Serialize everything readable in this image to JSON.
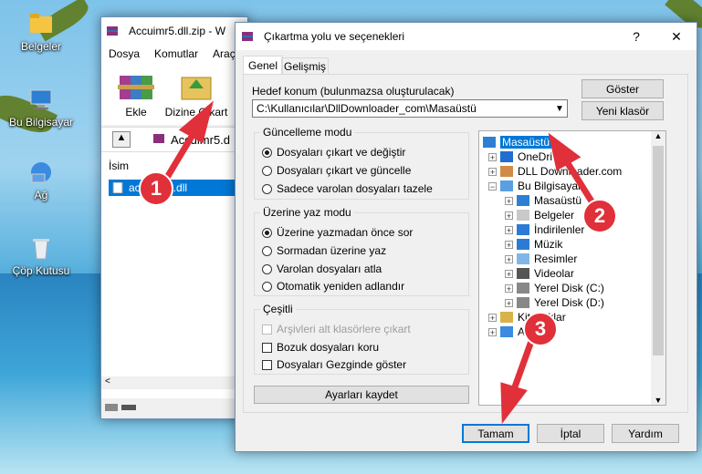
{
  "desktop": {
    "icons": [
      {
        "label": "Belgeler",
        "icon": "folder-icon"
      },
      {
        "label": "Bu Bilgisayar",
        "icon": "computer-icon"
      },
      {
        "label": "Ağ",
        "icon": "network-icon"
      },
      {
        "label": "Çöp Kutusu",
        "icon": "recycle-bin-icon"
      }
    ]
  },
  "winrar": {
    "title": "Accuimr5.dll.zip - W",
    "menu": [
      "Dosya",
      "Komutlar",
      "Araçla"
    ],
    "toolbar": {
      "add": "Ekle",
      "extract": "Dizine Çıkart"
    },
    "path": "Accuimr5.d",
    "column_name": "İsim",
    "file": "accuimr5.dll"
  },
  "dialog": {
    "title": "Çıkartma yolu ve seçenekleri",
    "help": "?",
    "close": "✕",
    "tabs": [
      "Genel",
      "Gelişmiş"
    ],
    "dest_label": "Hedef konum (bulunmazsa oluşturulacak)",
    "dest_value": "C:\\Kullanıcılar\\DllDownloader_com\\Masaüstü",
    "show_btn": "Göster",
    "newfolder_btn": "Yeni klasör",
    "update_group": {
      "title": "Güncelleme modu",
      "options": [
        "Dosyaları çıkart ve değiştir",
        "Dosyaları çıkart ve güncelle",
        "Sadece varolan dosyaları tazele"
      ],
      "selected": 0
    },
    "overwrite_group": {
      "title": "Üzerine yaz modu",
      "options": [
        "Üzerine yazmadan önce sor",
        "Sormadan üzerine yaz",
        "Varolan dosyaları atla",
        "Otomatik yeniden adlandır"
      ],
      "selected": 0
    },
    "misc_group": {
      "title": "Çeşitli",
      "options": [
        "Arşivleri alt klasörlere çıkart",
        "Bozuk dosyaları koru",
        "Dosyaları Gezginde göster"
      ]
    },
    "save_btn": "Ayarları kaydet",
    "tree": [
      {
        "label": "Masaüstü",
        "level": 0,
        "selected": true,
        "icon": "desktop-icon"
      },
      {
        "label": "OneDri",
        "level": 1,
        "icon": "cloud-icon"
      },
      {
        "label": "DLL Downloader.com",
        "level": 1,
        "icon": "user-icon"
      },
      {
        "label": "Bu Bilgisayar",
        "level": 1,
        "icon": "computer-icon"
      },
      {
        "label": "Masaüstü",
        "level": 2,
        "icon": "desktop-icon"
      },
      {
        "label": "Belgeler",
        "level": 2,
        "icon": "documents-icon"
      },
      {
        "label": "İndirilenler",
        "level": 2,
        "icon": "download-icon"
      },
      {
        "label": "Müzik",
        "level": 2,
        "icon": "music-icon"
      },
      {
        "label": "Resimler",
        "level": 2,
        "icon": "pictures-icon"
      },
      {
        "label": "Videolar",
        "level": 2,
        "icon": "video-icon"
      },
      {
        "label": "Yerel Disk (C:)",
        "level": 2,
        "icon": "disk-icon"
      },
      {
        "label": "Yerel Disk (D:)",
        "level": 2,
        "icon": "disk-icon"
      },
      {
        "label": "Kitaplıklar",
        "level": 1,
        "icon": "library-icon"
      },
      {
        "label": "Ağ",
        "level": 1,
        "icon": "network-icon"
      }
    ],
    "ok_btn": "Tamam",
    "cancel_btn": "İptal",
    "help_btn": "Yardım"
  },
  "annotations": [
    "1",
    "2",
    "3"
  ],
  "colors": {
    "accent": "#0078d7",
    "badge": "#e0303a",
    "selection": "#0078d7"
  }
}
